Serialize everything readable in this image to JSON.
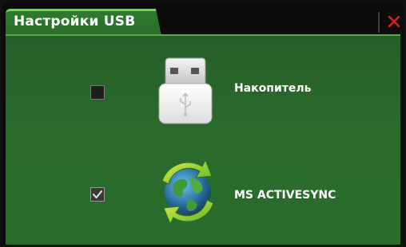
{
  "window": {
    "title": "Настройки USB"
  },
  "options": [
    {
      "label": "Накопитель",
      "checked": false,
      "icon": "usb-drive-icon"
    },
    {
      "label": "MS ACTIVESYNC",
      "checked": true,
      "icon": "activesync-globe-icon"
    }
  ],
  "colors": {
    "panel_green": "#2a6b2c",
    "tab_highlight": "#6dd94a",
    "close_red": "#e02020",
    "text": "#ffffff"
  }
}
